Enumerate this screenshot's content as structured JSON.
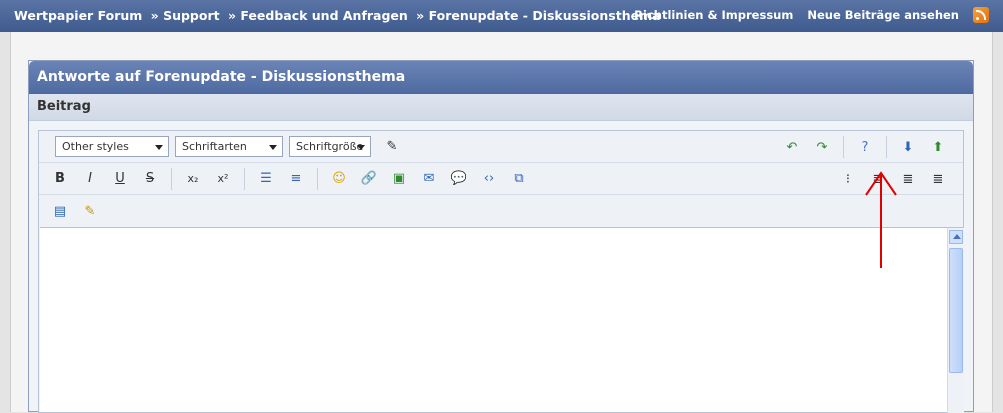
{
  "topbar": {
    "breadcrumb": [
      "Wertpapier Forum",
      "» Support",
      "» Feedback und Anfragen",
      "» Forenupdate - Diskussionsthema"
    ],
    "links": [
      "Richtlinien & Impressum",
      "Neue Beiträge ansehen"
    ],
    "icon": "rss-icon"
  },
  "panel": {
    "title": "Antworte auf Forenupdate - Diskussionsthema",
    "section": "Beitrag"
  },
  "editor": {
    "selects": {
      "styles": "Other styles",
      "fonts": "Schriftarten",
      "sizes": "Schriftgröße"
    },
    "row2": [
      "B",
      "I",
      "U",
      "S",
      "x₂",
      "x²"
    ]
  },
  "colors": {
    "accent": "#4e6aa0",
    "annotation": "#e00000"
  }
}
